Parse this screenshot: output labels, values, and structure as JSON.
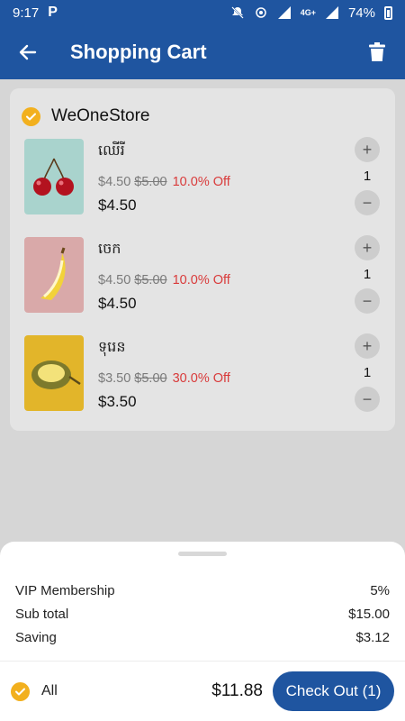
{
  "status_bar": {
    "time": "9:17",
    "network": "4G+",
    "battery": "74%"
  },
  "app_bar": {
    "title": "Shopping Cart"
  },
  "store": {
    "name": "WeOneStore",
    "items": [
      {
        "name": "ឈើរី",
        "price": "$4.50",
        "original_price": "$5.00",
        "discount": "10.0% Off",
        "final_price": "$4.50",
        "quantity": "1",
        "image": "cherry"
      },
      {
        "name": "ចេក",
        "price": "$4.50",
        "original_price": "$5.00",
        "discount": "10.0% Off",
        "final_price": "$4.50",
        "quantity": "1",
        "image": "banana"
      },
      {
        "name": "ទុរេន",
        "price": "$3.50",
        "original_price": "$5.00",
        "discount": "30.0% Off",
        "final_price": "$3.50",
        "quantity": "1",
        "image": "durian"
      }
    ]
  },
  "summary": {
    "vip_label": "VIP Membership",
    "vip_value": "5%",
    "subtotal_label": "Sub total",
    "subtotal_value": "$15.00",
    "saving_label": "Saving",
    "saving_value": "$3.12"
  },
  "footer": {
    "all_label": "All",
    "total": "$11.88",
    "checkout_label": "Check Out (1)"
  },
  "colors": {
    "primary": "#1f55a0",
    "accent": "#f2b01e",
    "discount": "#d93b3b"
  }
}
